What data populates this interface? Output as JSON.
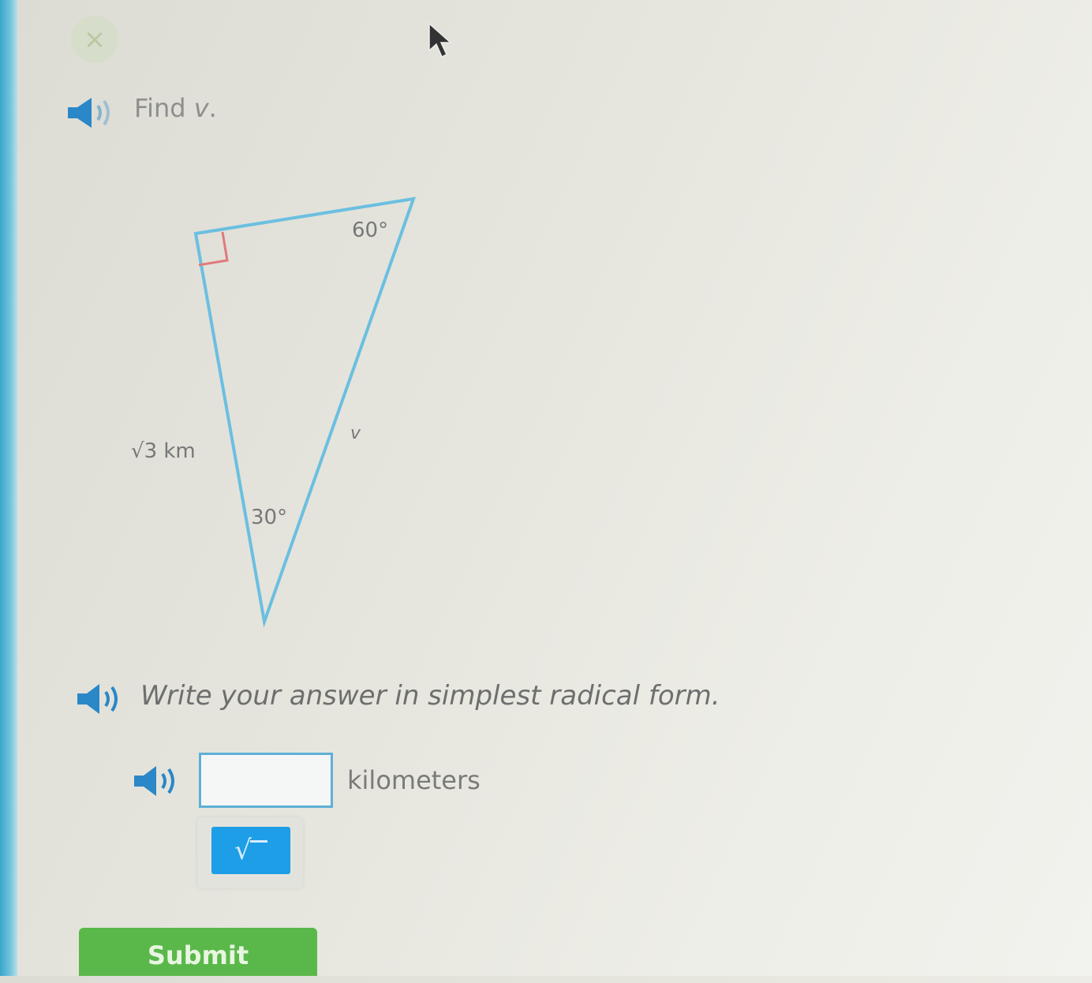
{
  "question": {
    "prompt_text": "Find ",
    "prompt_variable": "v",
    "prompt_period": "."
  },
  "diagram": {
    "top_angle": "60°",
    "bottom_angle": "30°",
    "side_label": "√3 km",
    "side_variable": "v",
    "line_color": "#6bbfe0",
    "right_angle_color": "#e07a7a"
  },
  "instruction": "Write your answer in simplest radical form.",
  "answer": {
    "value": "",
    "placeholder": "",
    "unit": "kilometers"
  },
  "toolbar": {
    "radical_symbol": "√"
  },
  "submit_label": "Submit",
  "icons": {
    "close": "close-icon",
    "audio": "speaker-icon",
    "cursor": "cursor-icon"
  },
  "colors": {
    "accent_blue": "#1d9ee6",
    "submit_green": "#5ab84a"
  }
}
